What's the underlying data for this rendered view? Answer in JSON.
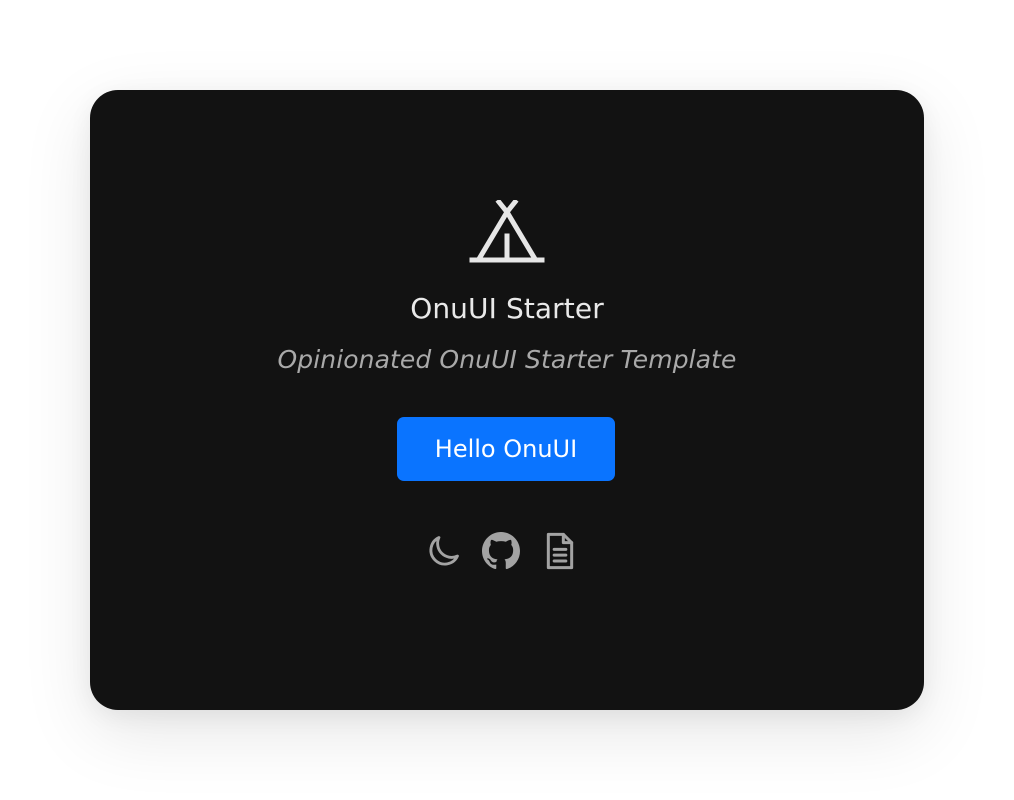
{
  "app": {
    "title": "OnuUI Starter",
    "subtitle": "Opinionated OnuUI Starter Template"
  },
  "actions": {
    "primary_label": "Hello OnuUI"
  },
  "icons": {
    "logo": "tent-icon",
    "theme_toggle": "moon-icon",
    "repository": "github-icon",
    "docs": "document-icon"
  },
  "colors": {
    "background": "#ffffff",
    "card": "#121212",
    "title": "#e9e9e9",
    "subtitle": "#a9a9a9",
    "primary": "#0a74ff",
    "icon": "#a3a3a3"
  }
}
